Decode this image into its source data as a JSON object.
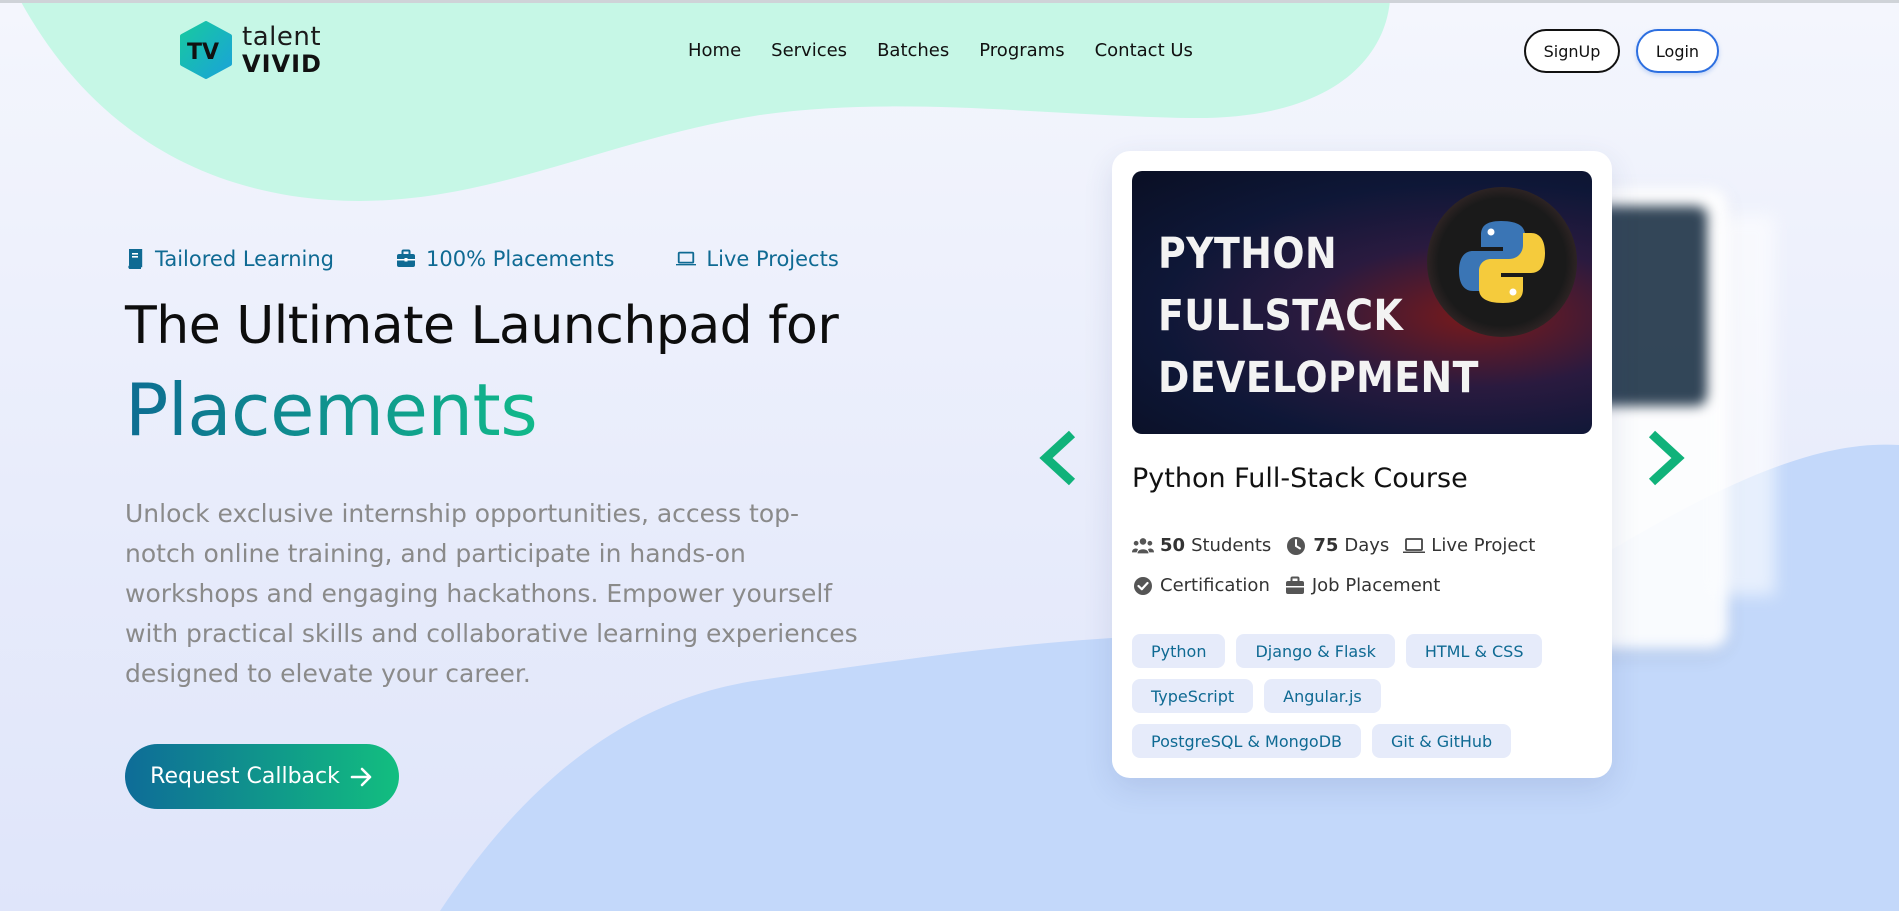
{
  "header": {
    "logo": {
      "top": "talent",
      "bottom": "VIVID",
      "mark": "TV"
    },
    "nav": [
      "Home",
      "Services",
      "Batches",
      "Programs",
      "Contact Us"
    ],
    "signup_label": "SignUp",
    "login_label": "Login"
  },
  "hero": {
    "features": [
      {
        "icon": "book-icon",
        "label": "Tailored Learning"
      },
      {
        "icon": "briefcase-icon",
        "label": "100% Placements"
      },
      {
        "icon": "laptop-icon",
        "label": "Live Projects"
      }
    ],
    "headline": "The Ultimate Launchpad for",
    "accent": "Placements",
    "description": "Unlock exclusive internship opportunities, access top-notch online training, and participate in hands-on workshops and engaging hackathons. Empower yourself with practical skills and collaborative learning experiences designed to elevate your career.",
    "cta_label": "Request Callback",
    "accent_gradient": [
      "#0d6d92",
      "#11b98a"
    ]
  },
  "course_card": {
    "image_text": [
      "PYTHON",
      "FULLSTACK",
      "DEVELOPMENT"
    ],
    "title": "Python Full-Stack Course",
    "meta": {
      "students_count": "50",
      "students_label": "Students",
      "days_count": "75",
      "days_label": "Days",
      "project": "Live Project",
      "certification": "Certification",
      "placement": "Job Placement"
    },
    "tags": [
      "Python",
      "Django & Flask",
      "HTML & CSS",
      "TypeScript",
      "Angular.js",
      "PostgreSQL & MongoDB",
      "Git & GitHub"
    ]
  },
  "colors": {
    "brand_teal": "#0f6a93",
    "brand_green": "#11b98a",
    "mint_blob": "#c6f7e6",
    "blue_blob": "#c3d8fa",
    "login_border": "#2d6fe0"
  }
}
